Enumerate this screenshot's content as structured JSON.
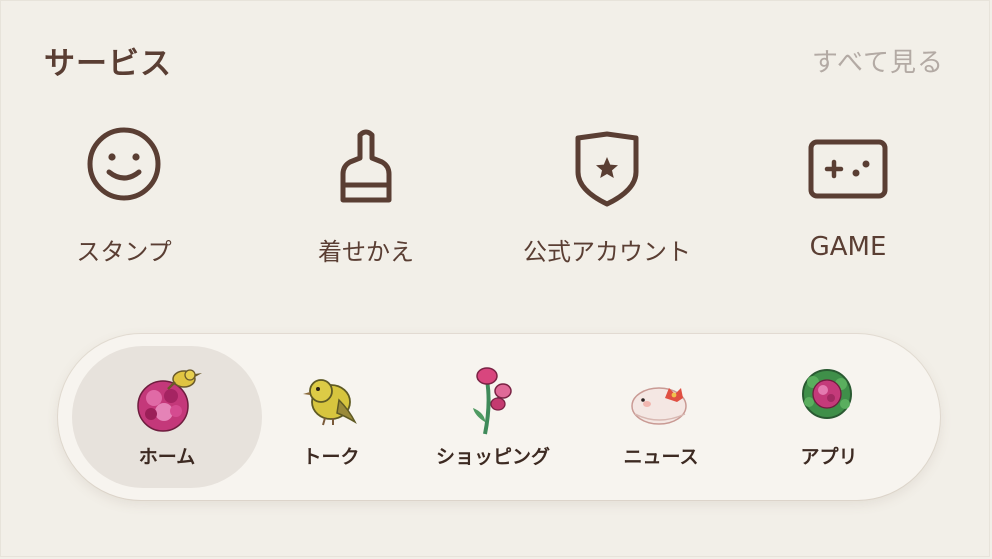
{
  "header": {
    "title": "サービス",
    "see_all": "すべて見る"
  },
  "services": [
    {
      "label": "スタンプ",
      "icon": "smiley-icon"
    },
    {
      "label": "着せかえ",
      "icon": "brush-icon"
    },
    {
      "label": "公式アカウント",
      "icon": "shield-star-icon"
    },
    {
      "label": "GAME",
      "icon": "game-controller-icon"
    }
  ],
  "bottom_nav": {
    "items": [
      {
        "label": "ホーム",
        "icon": "flower-with-bird-icon",
        "active": true
      },
      {
        "label": "トーク",
        "icon": "yellow-bird-icon",
        "active": false
      },
      {
        "label": "ショッピング",
        "icon": "flower-stem-icon",
        "active": false
      },
      {
        "label": "ニュース",
        "icon": "bird-with-flower-icon",
        "active": false
      },
      {
        "label": "アプリ",
        "icon": "green-wreath-flower-icon",
        "active": false
      }
    ]
  },
  "colors": {
    "background": "#f2efe8",
    "text": "#5a3e33",
    "muted": "#b3aaa4",
    "icon_stroke": "#5a3e33",
    "active_tab": "#e7e2dc"
  }
}
